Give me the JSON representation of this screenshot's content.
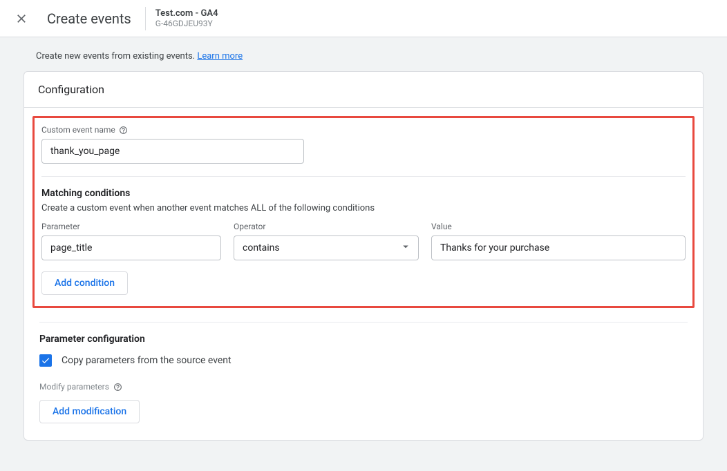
{
  "header": {
    "title": "Create events",
    "property_name": "Test.com - GA4",
    "property_id": "G-46GDJEU93Y"
  },
  "intro": {
    "text": "Create new events from existing events.",
    "link_text": "Learn more"
  },
  "card": {
    "title": "Configuration"
  },
  "custom_event": {
    "label": "Custom event name",
    "value": "thank_you_page"
  },
  "matching": {
    "title": "Matching conditions",
    "subtitle": "Create a custom event when another event matches ALL of the following conditions",
    "parameter_label": "Parameter",
    "operator_label": "Operator",
    "value_label": "Value",
    "conditions": [
      {
        "parameter": "page_title",
        "operator": "contains",
        "value": "Thanks for your purchase"
      }
    ],
    "add_button": "Add condition"
  },
  "param_config": {
    "title": "Parameter configuration",
    "copy_checkbox_label": "Copy parameters from the source event",
    "copy_checked": true,
    "modify_label": "Modify parameters",
    "add_modification_button": "Add modification"
  }
}
